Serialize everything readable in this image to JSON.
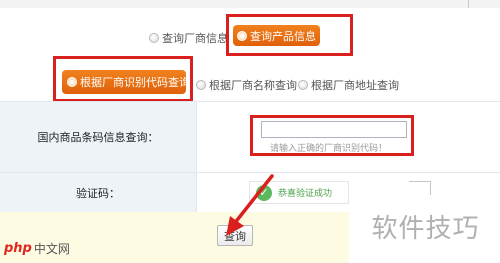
{
  "top_radios": {
    "manufacturer_info": "查询厂商信息",
    "product_info": "查询产品信息"
  },
  "query_mode_radios": {
    "by_code": "根据厂商识别代码查询",
    "by_name": "根据厂商名称查询",
    "by_address": "根据厂商地址查询"
  },
  "form": {
    "barcode_label": "国内商品条码信息查询：",
    "barcode_input_value": "",
    "barcode_hint": "请输入正确的厂商识别代码！",
    "captcha_label": "验证码：",
    "captcha_status": "恭喜验证成功",
    "captcha_status_icon": "check-icon"
  },
  "actions": {
    "query_button": "查询"
  },
  "watermarks": {
    "right": "软件技巧",
    "logo": "php",
    "left": "中文网"
  },
  "colors": {
    "accent_orange": "#e86d12",
    "highlight_red": "#d9201f",
    "label_bg": "#eef3f8",
    "success_green": "#5cb85c"
  }
}
